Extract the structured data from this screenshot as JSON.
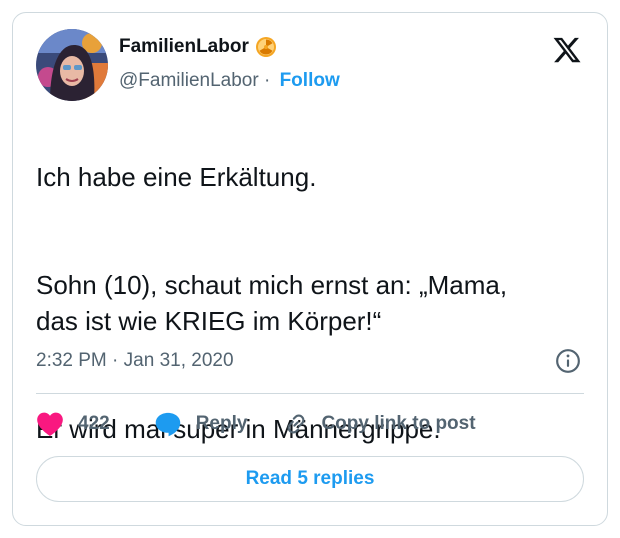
{
  "author": {
    "display_name": "FamilienLabor",
    "handle": "@FamilienLabor",
    "separator": "·",
    "follow_label": "Follow",
    "badge_icon": "radioactive-icon",
    "badge_color": "#f5a623"
  },
  "tweet": {
    "paragraphs": [
      "Ich habe eine Erkältung.",
      "Sohn (10), schaut mich ernst an: „Mama,\ndas ist wie KRIEG im Körper!“",
      "Er wird mal super in Männergrippe."
    ],
    "time": "2:32 PM",
    "meta_separator": "·",
    "date": "Jan 31, 2020"
  },
  "actions": {
    "like_count": "422",
    "reply_label": "Reply",
    "copy_label": "Copy link to post"
  },
  "read_replies_label": "Read 5 replies",
  "colors": {
    "accent": "#1d9bf0",
    "like": "#f91880",
    "text": "#0f1419",
    "muted": "#536471",
    "border": "#cfd9de"
  }
}
